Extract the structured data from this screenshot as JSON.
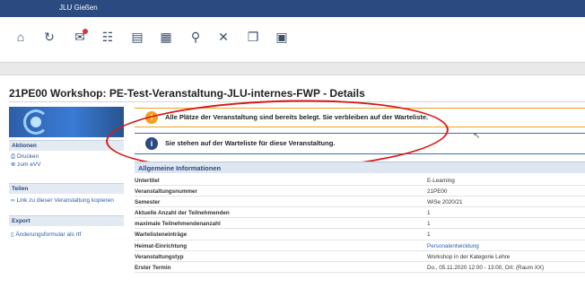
{
  "header": {
    "brand": "JLU Gießen"
  },
  "nav_icons": [
    {
      "icon": "home-icon",
      "glyph": "⌂"
    },
    {
      "icon": "refresh-icon",
      "glyph": "↻"
    },
    {
      "icon": "mail-icon",
      "glyph": "✉"
    },
    {
      "icon": "users-icon",
      "glyph": "☷"
    },
    {
      "icon": "bookmark-icon",
      "glyph": "▤"
    },
    {
      "icon": "calendar-icon",
      "glyph": "▦"
    },
    {
      "icon": "search-icon",
      "glyph": "⚲"
    },
    {
      "icon": "tools-icon",
      "glyph": "✕"
    },
    {
      "icon": "copy-icon",
      "glyph": "❐"
    },
    {
      "icon": "window-icon",
      "glyph": "▣"
    }
  ],
  "page": {
    "title": "21PE00 Workshop: PE-Test-Veranstaltung-JLU-internes-FWP - Details"
  },
  "sidebar": {
    "actions_heading": "Aktionen",
    "actions": [
      "Drucken",
      "zum eVV"
    ],
    "share_heading": "Teilen",
    "share_link": "Link zu dieser Veranstaltung kopieren",
    "export_heading": "Export",
    "export_link": "Änderungsformular als rtf"
  },
  "alerts": {
    "warning": "Alle Plätze der Veranstaltung sind bereits belegt. Sie verbleiben auf der Warteliste.",
    "info": "Sie stehen auf der Warteliste für diese Veranstaltung."
  },
  "section": {
    "title": "Allgemeine Informationen"
  },
  "details": [
    {
      "label": "Untertitel",
      "value": "E-Learning"
    },
    {
      "label": "Veranstaltungsnummer",
      "value": "21PE00"
    },
    {
      "label": "Semester",
      "value": "WiSe 2020/21"
    },
    {
      "label": "Aktuelle Anzahl der Teilnehmenden",
      "value": "1"
    },
    {
      "label": "maximale Teilnehmendenanzahl",
      "value": "1"
    },
    {
      "label": "Wartelisteneinträge",
      "value": "1"
    },
    {
      "label": "Heimat-Einrichtung",
      "value": "Personalentwicklung",
      "link": true
    },
    {
      "label": "Veranstaltungstyp",
      "value": "Workshop in der Kategorie Lehre"
    },
    {
      "label": "Erster Termin",
      "value": "Do., 05.11.2020 12:00 - 13:00, Ort: (Raum XX)"
    }
  ],
  "colors": {
    "header": "#2b4a80",
    "warning": "#f0a020",
    "annotation_ring": "#d61a1a"
  }
}
